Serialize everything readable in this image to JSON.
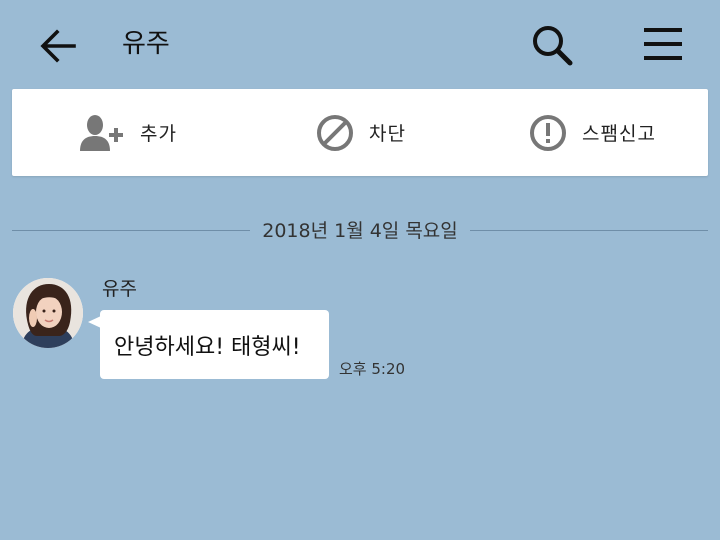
{
  "header": {
    "back_icon": "arrow-left-icon",
    "title": "유주",
    "search_icon": "search-icon",
    "menu_icon": "hamburger-menu-icon"
  },
  "actions": [
    {
      "label": "추가",
      "icon": "add-friend-icon"
    },
    {
      "label": "차단",
      "icon": "block-icon"
    },
    {
      "label": "스팸신고",
      "icon": "report-spam-icon"
    }
  ],
  "chat": {
    "date": "2018년 1월 4일 목요일",
    "messages": [
      {
        "sender": "유주",
        "text": "안녕하세요! 태형씨!",
        "time": "오후 5:20",
        "avatar_icon": "profile-photo"
      }
    ]
  },
  "colors": {
    "background": "#9bbbd4",
    "bubble": "#ffffff",
    "icon_gray": "#777777"
  }
}
